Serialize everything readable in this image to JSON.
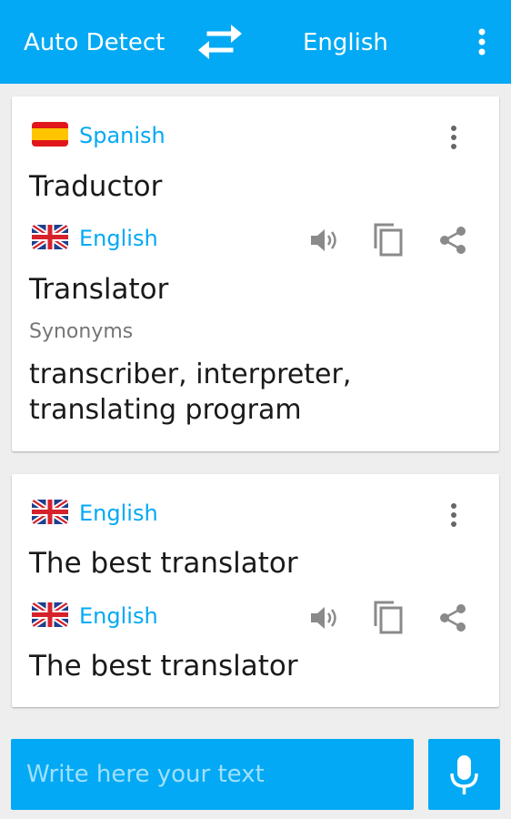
{
  "header": {
    "source_language": "Auto Detect",
    "target_language": "English",
    "swap_icon": "swap-arrows-icon",
    "menu_icon": "more-vert-icon"
  },
  "cards": [
    {
      "source": {
        "flag": "spain-flag",
        "language": "Spanish",
        "text": "Traductor"
      },
      "translation": {
        "flag": "uk-flag",
        "language": "English",
        "text": "Translator"
      },
      "synonyms_label": "Synonyms",
      "synonyms": "transcriber, interpreter, translating program",
      "actions": [
        "volume-icon",
        "copy-icon",
        "share-icon"
      ]
    },
    {
      "source": {
        "flag": "uk-flag",
        "language": "English",
        "text": "The best translator"
      },
      "translation": {
        "flag": "uk-flag",
        "language": "English",
        "text": "The best translator"
      },
      "actions": [
        "volume-icon",
        "copy-icon",
        "share-icon"
      ]
    }
  ],
  "input": {
    "placeholder": "Write here your text"
  },
  "mic_icon": "microphone-icon",
  "colors": {
    "accent": "#03a9f4",
    "text": "#1a1a1a",
    "muted": "#757575",
    "icon_grey": "#8a8a8a"
  }
}
